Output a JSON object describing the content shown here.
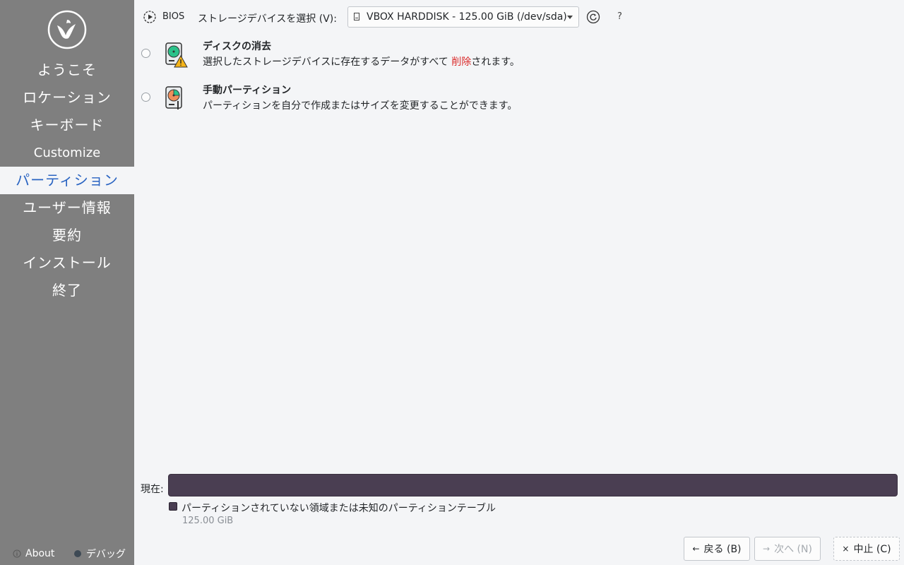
{
  "sidebar": {
    "items": [
      {
        "label": "ようこそ"
      },
      {
        "label": "ロケーション"
      },
      {
        "label": "キーボード"
      },
      {
        "label": "Customize"
      },
      {
        "label": "パーティション"
      },
      {
        "label": "ユーザー情報"
      },
      {
        "label": "要約"
      },
      {
        "label": "インストール"
      },
      {
        "label": "終了"
      }
    ],
    "active_index": 4,
    "about_label": "About",
    "debug_label": "デバッグ"
  },
  "toolbar": {
    "bios_label": "BIOS",
    "storage_label": "ストレージデバイスを選択 (V):",
    "device_value": "VBOX HARDDISK - 125.00 GiB (/dev/sda)",
    "help_label": "?"
  },
  "options": {
    "erase": {
      "title": "ディスクの消去",
      "desc_before": "選択したストレージデバイスに存在するデータがすべて ",
      "desc_danger": "削除",
      "desc_after": "されます。"
    },
    "manual": {
      "title": "手動パーティション",
      "desc": "パーティションを自分で作成またはサイズを変更することができます。"
    }
  },
  "current": {
    "label": "現在:",
    "legend_text": "パーティションされていない領域または未知のパーティションテーブル",
    "legend_size": "125.00 GiB"
  },
  "buttons": {
    "back": "戻る (B)",
    "next": "次へ (N)",
    "cancel": "中止 (C)"
  },
  "colors": {
    "sidebar_bg": "#7f7f7f",
    "active_text": "#2a64c2",
    "danger": "#da2a2a",
    "partition_bar": "#4a3e52"
  }
}
